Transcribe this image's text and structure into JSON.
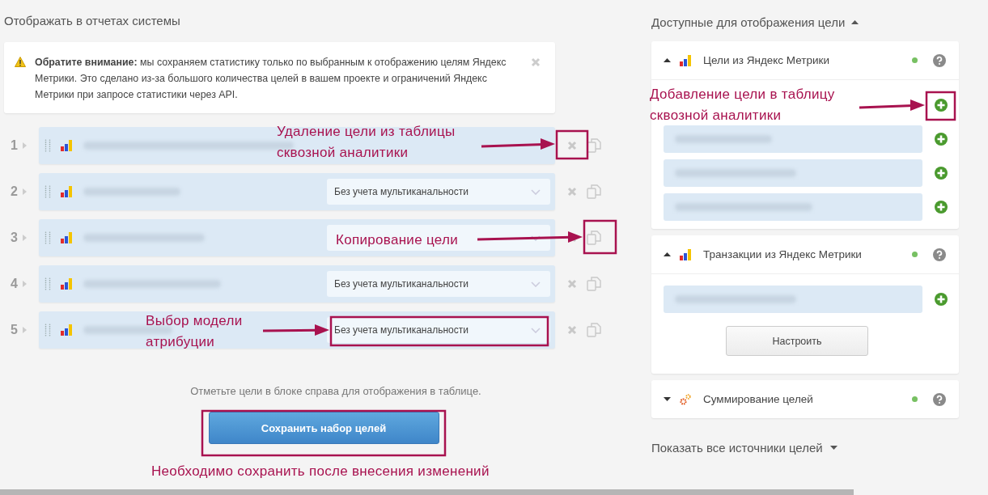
{
  "left": {
    "title": "Отображать в отчетах системы",
    "notice": {
      "text": "**Обратите внимание:** мы сохраняем статистику только по выбранным к отображению целям Яндекс Метрики. Это сделано из-за большого количества целей в вашем проекте и ограничений Яндекс Метрики при запросе статистики через API."
    },
    "rows": [
      {
        "number": "1"
      },
      {
        "number": "2",
        "attribution": "Без учета мультиканальности"
      },
      {
        "number": "3"
      },
      {
        "number": "4",
        "attribution": "Без учета мультиканальности"
      },
      {
        "number": "5",
        "attribution": "Без учета мультиканальности"
      }
    ],
    "hint": "Отметьте цели в блоке справа для отображения в таблице.",
    "save_button": "Сохранить набор целей"
  },
  "right": {
    "title": "Доступные для отображения цели",
    "sections": [
      {
        "title": "Цели из Яндекс Метрики",
        "kind": "metrika",
        "expanded": true
      },
      {
        "title": "Транзакции из Яндекс Метрики",
        "kind": "metrika",
        "expanded": true,
        "button": "Настроить"
      },
      {
        "title": "Суммирование целей",
        "kind": "sum",
        "expanded": false
      }
    ],
    "show_all": "Показать все источники целей"
  },
  "annotations": [
    {
      "lines": [
        "Удаление цели из таблицы",
        "сквозной аналитики"
      ]
    },
    {
      "lines": [
        "Копирование цели"
      ]
    },
    {
      "lines": [
        "Выбор модели",
        "атрибуции"
      ]
    },
    {
      "lines": [
        "Добавление цели в таблицу",
        "сквозной аналитики"
      ]
    },
    {
      "lines": [
        "Необходимо сохранить после внесения изменений"
      ]
    }
  ]
}
